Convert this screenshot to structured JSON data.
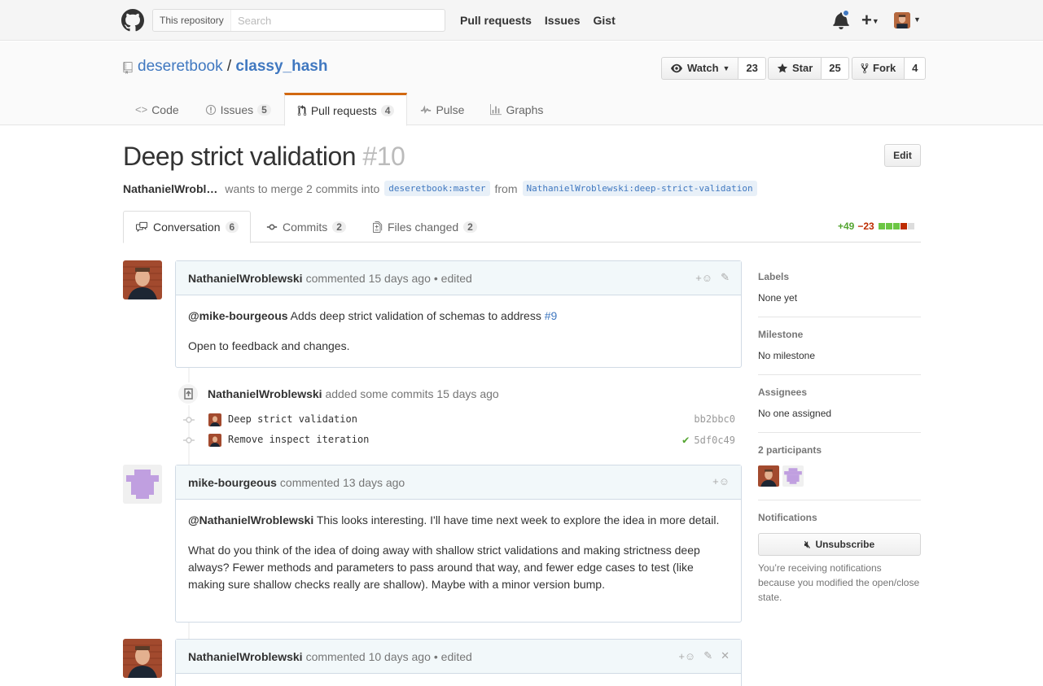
{
  "header": {
    "search_scope": "This repository",
    "search_placeholder": "Search",
    "nav": [
      "Pull requests",
      "Issues",
      "Gist"
    ]
  },
  "repo": {
    "owner": "deseretbook",
    "separator": "/",
    "name": "classy_hash",
    "watch_label": "Watch",
    "watch_count": "23",
    "star_label": "Star",
    "star_count": "25",
    "fork_label": "Fork",
    "fork_count": "4",
    "tabs": [
      {
        "label": "Code",
        "icon": "code-icon",
        "count": null
      },
      {
        "label": "Issues",
        "icon": "issue-icon",
        "count": "5"
      },
      {
        "label": "Pull requests",
        "icon": "pull-request-icon",
        "count": "4"
      },
      {
        "label": "Pulse",
        "icon": "pulse-icon",
        "count": null
      },
      {
        "label": "Graphs",
        "icon": "graph-icon",
        "count": null
      }
    ]
  },
  "pr": {
    "title": "Deep strict validation",
    "number": "#10",
    "edit_label": "Edit",
    "author": "NathanielWrobl…",
    "merge_text": "wants to merge 2 commits into",
    "base_ref": "deseretbook:master",
    "from_text": "from",
    "head_ref": "NathanielWroblewski:deep-strict-validation",
    "tabs": {
      "conversation": {
        "label": "Conversation",
        "count": "6"
      },
      "commits": {
        "label": "Commits",
        "count": "2"
      },
      "files": {
        "label": "Files changed",
        "count": "2"
      }
    },
    "additions": "+49",
    "deletions": "−23"
  },
  "timeline": {
    "comment1": {
      "author": "NathanielWroblewski",
      "action": "commented 15 days ago",
      "edited": "• edited",
      "mention": "@mike-bourgeous",
      "line1": " Adds deep strict validation of schemas to address ",
      "issue_link": "#9",
      "line2": "Open to feedback and changes."
    },
    "commits_event": {
      "author": "NathanielWroblewski",
      "action": "added some commits 15 days ago",
      "commits": [
        {
          "message": "Deep strict validation",
          "sha": "bb2bbc0"
        },
        {
          "message": "Remove inspect iteration",
          "sha": "5df0c49"
        }
      ]
    },
    "comment2": {
      "author": "mike-bourgeous",
      "action": "commented 13 days ago",
      "mention": "@NathanielWroblewski",
      "p1_rest": " This looks interesting. I'll have time next week to explore the idea in more detail.",
      "p2": "What do you think of the idea of doing away with shallow strict validations and making strictness deep always? Fewer methods and parameters to pass around that way, and fewer edge cases to test (like making sure shallow checks really are shallow). Maybe with a minor version bump."
    },
    "comment3": {
      "author": "NathanielWroblewski",
      "action": "commented 10 days ago",
      "edited": "• edited"
    }
  },
  "sidebar": {
    "labels_title": "Labels",
    "labels_value": "None yet",
    "milestone_title": "Milestone",
    "milestone_value": "No milestone",
    "assignees_title": "Assignees",
    "assignees_value": "No one assigned",
    "participants_title": "2 participants",
    "notifications_title": "Notifications",
    "unsubscribe_label": "Unsubscribe",
    "notification_reason": "You’re receiving notifications because you modified the open/close state."
  },
  "colors": {
    "link": "#4078c0",
    "tab_accent": "#d26911",
    "addition": "#55a532",
    "deletion": "#bd2c00"
  }
}
